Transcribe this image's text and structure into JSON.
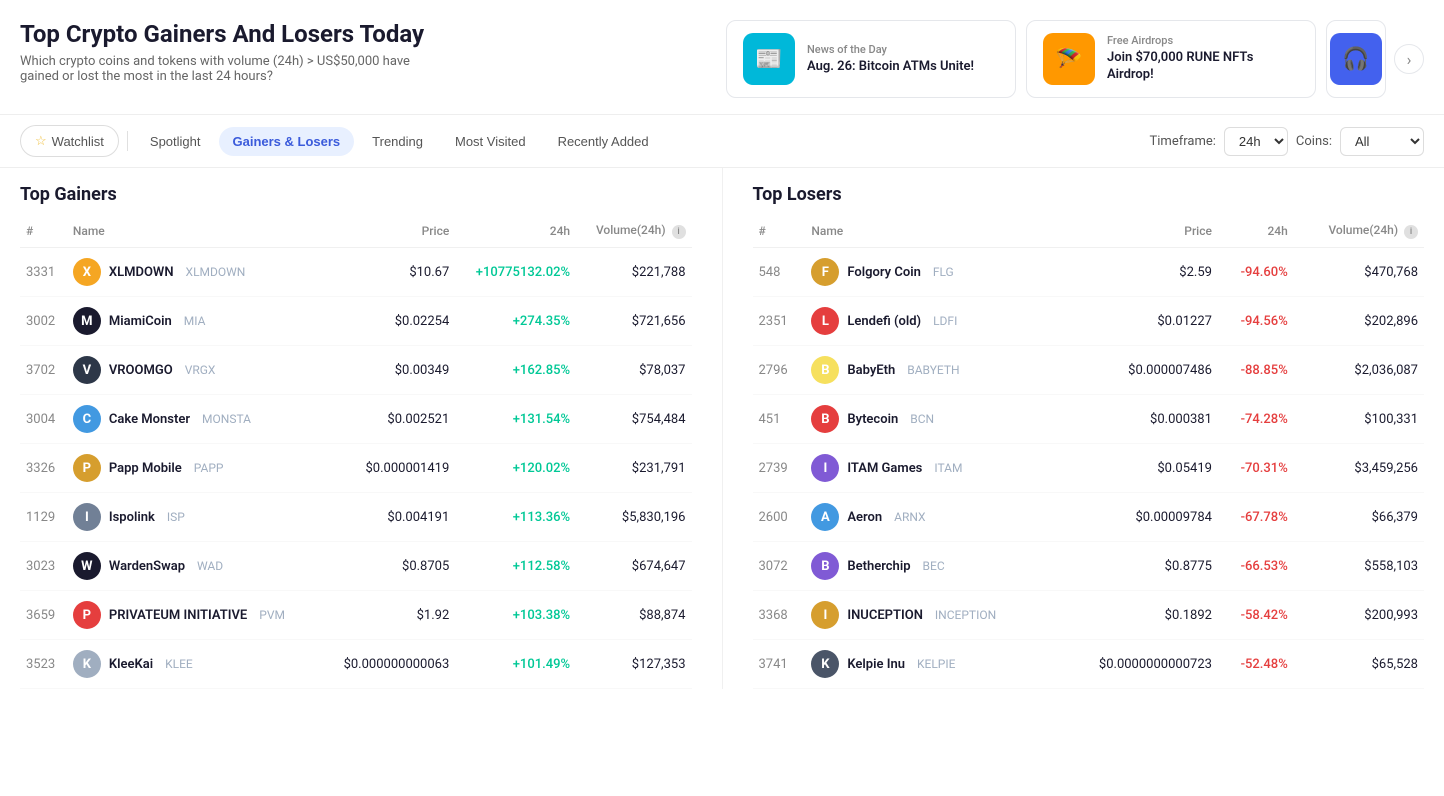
{
  "page": {
    "title": "Top Crypto Gainers And Losers Today",
    "subtitle": "Which crypto coins and tokens with volume (24h) > US$50,000 have gained or lost the most in the last 24 hours?"
  },
  "newsCards": [
    {
      "id": "news1",
      "label": "News of the Day",
      "title": "Aug. 26: Bitcoin ATMs Unite!",
      "iconEmoji": "📰",
      "iconColor": "teal"
    },
    {
      "id": "news2",
      "label": "Free Airdrops",
      "title": "Join $70,000 RUNE NFTs Airdrop!",
      "iconEmoji": "🪂",
      "iconColor": "orange"
    },
    {
      "id": "news3",
      "label": "",
      "title": "",
      "iconEmoji": "🎧",
      "iconColor": "blue"
    }
  ],
  "tabs": [
    {
      "id": "watchlist",
      "label": "Watchlist",
      "active": false,
      "watchlist": true
    },
    {
      "id": "spotlight",
      "label": "Spotlight",
      "active": false
    },
    {
      "id": "gainers-losers",
      "label": "Gainers & Losers",
      "active": true
    },
    {
      "id": "trending",
      "label": "Trending",
      "active": false
    },
    {
      "id": "most-visited",
      "label": "Most Visited",
      "active": false
    },
    {
      "id": "recently-added",
      "label": "Recently Added",
      "active": false
    }
  ],
  "timeframeLabel": "Timeframe:",
  "timeframeValue": "24h",
  "coinsLabel": "Coins:",
  "coinsValue": "All",
  "gainersTitle": "Top Gainers",
  "losersTitle": "Top Losers",
  "tableHeaders": {
    "rank": "#",
    "name": "Name",
    "price": "Price",
    "change24h": "24h",
    "volume": "Volume(24h)"
  },
  "gainers": [
    {
      "rank": "3331",
      "name": "XLMDOWN",
      "symbol": "XLMDOWN",
      "price": "$10.67",
      "change": "+10775132.02%",
      "volume": "$221,788",
      "iconColor": "#f5a623",
      "iconText": "X"
    },
    {
      "rank": "3002",
      "name": "MiamiCoin",
      "symbol": "MIA",
      "price": "$0.02254",
      "change": "+274.35%",
      "volume": "$721,656",
      "iconColor": "#1a1a2e",
      "iconText": "M"
    },
    {
      "rank": "3702",
      "name": "VROOMGO",
      "symbol": "VRGX",
      "price": "$0.00349",
      "change": "+162.85%",
      "volume": "$78,037",
      "iconColor": "#2d3748",
      "iconText": "V"
    },
    {
      "rank": "3004",
      "name": "Cake Monster",
      "symbol": "MONSTA",
      "price": "$0.002521",
      "change": "+131.54%",
      "volume": "$754,484",
      "iconColor": "#4299e1",
      "iconText": "C"
    },
    {
      "rank": "3326",
      "name": "Papp Mobile",
      "symbol": "PAPP",
      "price": "$0.000001419",
      "change": "+120.02%",
      "volume": "$231,791",
      "iconColor": "#d69e2e",
      "iconText": "P"
    },
    {
      "rank": "1129",
      "name": "Ispolink",
      "symbol": "ISP",
      "price": "$0.004191",
      "change": "+113.36%",
      "volume": "$5,830,196",
      "iconColor": "#718096",
      "iconText": "I"
    },
    {
      "rank": "3023",
      "name": "WardenSwap",
      "symbol": "WAD",
      "price": "$0.8705",
      "change": "+112.58%",
      "volume": "$674,647",
      "iconColor": "#1a1a2e",
      "iconText": "W"
    },
    {
      "rank": "3659",
      "name": "PRIVATEUM INITIATIVE",
      "symbol": "PVM",
      "price": "$1.92",
      "change": "+103.38%",
      "volume": "$88,874",
      "iconColor": "#e53e3e",
      "iconText": "P"
    },
    {
      "rank": "3523",
      "name": "KleeKai",
      "symbol": "KLEE",
      "price": "$0.000000000063",
      "change": "+101.49%",
      "volume": "$127,353",
      "iconColor": "#a0aec0",
      "iconText": "K"
    }
  ],
  "losers": [
    {
      "rank": "548",
      "name": "Folgory Coin",
      "symbol": "FLG",
      "price": "$2.59",
      "change": "-94.60%",
      "volume": "$470,768",
      "iconColor": "#d69e2e",
      "iconText": "F"
    },
    {
      "rank": "2351",
      "name": "Lendefi (old)",
      "symbol": "LDFI",
      "price": "$0.01227",
      "change": "-94.56%",
      "volume": "$202,896",
      "iconColor": "#e53e3e",
      "iconText": "L"
    },
    {
      "rank": "2796",
      "name": "BabyEth",
      "symbol": "BABYETH",
      "price": "$0.000007486",
      "change": "-88.85%",
      "volume": "$2,036,087",
      "iconColor": "#f6e05e",
      "iconText": "B"
    },
    {
      "rank": "451",
      "name": "Bytecoin",
      "symbol": "BCN",
      "price": "$0.000381",
      "change": "-74.28%",
      "volume": "$100,331",
      "iconColor": "#e53e3e",
      "iconText": "B"
    },
    {
      "rank": "2739",
      "name": "ITAM Games",
      "symbol": "ITAM",
      "price": "$0.05419",
      "change": "-70.31%",
      "volume": "$3,459,256",
      "iconColor": "#805ad5",
      "iconText": "I"
    },
    {
      "rank": "2600",
      "name": "Aeron",
      "symbol": "ARNX",
      "price": "$0.00009784",
      "change": "-67.78%",
      "volume": "$66,379",
      "iconColor": "#4299e1",
      "iconText": "A"
    },
    {
      "rank": "3072",
      "name": "Betherchip",
      "symbol": "BEC",
      "price": "$0.8775",
      "change": "-66.53%",
      "volume": "$558,103",
      "iconColor": "#805ad5",
      "iconText": "B"
    },
    {
      "rank": "3368",
      "name": "INUCEPTION",
      "symbol": "INCEPTION",
      "price": "$0.1892",
      "change": "-58.42%",
      "volume": "$200,993",
      "iconColor": "#d69e2e",
      "iconText": "I"
    },
    {
      "rank": "3741",
      "name": "Kelpie Inu",
      "symbol": "KELPIE",
      "price": "$0.0000000000723",
      "change": "-52.48%",
      "volume": "$65,528",
      "iconColor": "#4a5568",
      "iconText": "K"
    }
  ]
}
